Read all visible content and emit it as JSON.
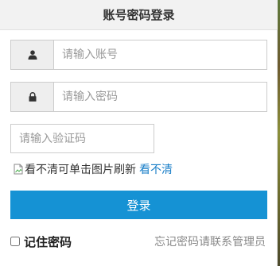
{
  "header": {
    "title": "账号密码登录"
  },
  "account": {
    "placeholder": "请输入账号",
    "icon": "user-icon"
  },
  "password": {
    "placeholder": "请输入密码",
    "icon": "lock-icon"
  },
  "captcha": {
    "placeholder": "请输入验证码",
    "image_alt": "看不清可单击图片刷新",
    "refresh_link": "看不清"
  },
  "login_button": {
    "label": "登录",
    "color": "#1592d4"
  },
  "remember": {
    "label": "记住密码",
    "checked": false
  },
  "forgot": {
    "text": "忘记密码请联系管理员"
  }
}
